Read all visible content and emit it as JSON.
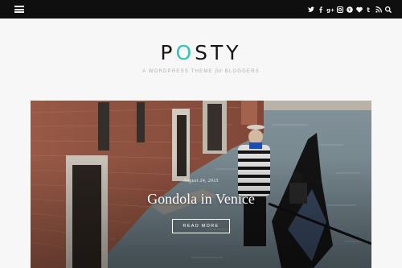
{
  "topbar": {
    "menu_icon": "hamburger-menu-icon",
    "social_icons": [
      "twitter-icon",
      "facebook-icon",
      "google-plus-icon",
      "instagram-icon",
      "pinterest-icon",
      "bloglovin-icon",
      "tumblr-icon",
      "rss-icon",
      "search-icon"
    ]
  },
  "header": {
    "logo_pre": "P",
    "logo_accent": "O",
    "logo_post": "STY",
    "tagline_pre": "A WordPress Theme",
    "tagline_for": "for",
    "tagline_post": "Bloggers",
    "accent_color": "#2ec4b6"
  },
  "featured": {
    "date": "August 24, 2015",
    "title": "Gondola in Venice",
    "button_label": "Read More"
  }
}
